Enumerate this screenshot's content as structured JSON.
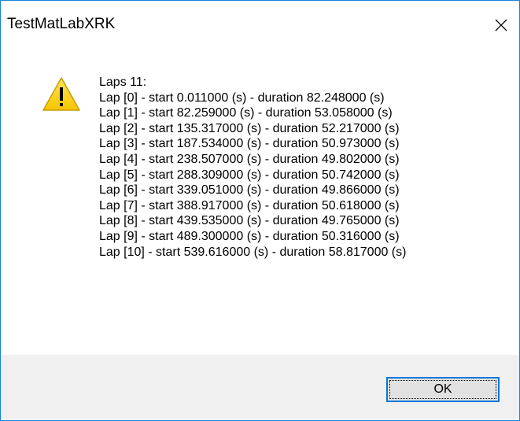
{
  "window": {
    "title": "TestMatLabXRK",
    "close_icon": "close-icon"
  },
  "message": {
    "icon": "warning-icon",
    "lines": [
      "Laps 11:",
      "Lap [0] - start 0.011000 (s) - duration 82.248000 (s)",
      "Lap [1] - start 82.259000 (s) - duration 53.058000 (s)",
      "Lap [2] - start 135.317000 (s) - duration 52.217000 (s)",
      "Lap [3] - start 187.534000 (s) - duration 50.973000 (s)",
      "Lap [4] - start 238.507000 (s) - duration 49.802000 (s)",
      "Lap [5] - start 288.309000 (s) - duration 50.742000 (s)",
      "Lap [6] - start 339.051000 (s) - duration 49.866000 (s)",
      "Lap [7] - start 388.917000 (s) - duration 50.618000 (s)",
      "Lap [8] - start 439.535000 (s) - duration 49.765000 (s)",
      "Lap [9] - start 489.300000 (s) - duration 50.316000 (s)",
      "Lap [10] - start 539.616000 (s) - duration 58.817000 (s)"
    ]
  },
  "buttons": {
    "ok_label": "OK"
  },
  "colors": {
    "window_border": "#1883d7",
    "footer_background": "#f0f0f0",
    "button_background": "#e1e1e1",
    "button_focus_border": "#0078d7",
    "warning_fill": "#fcd116"
  }
}
